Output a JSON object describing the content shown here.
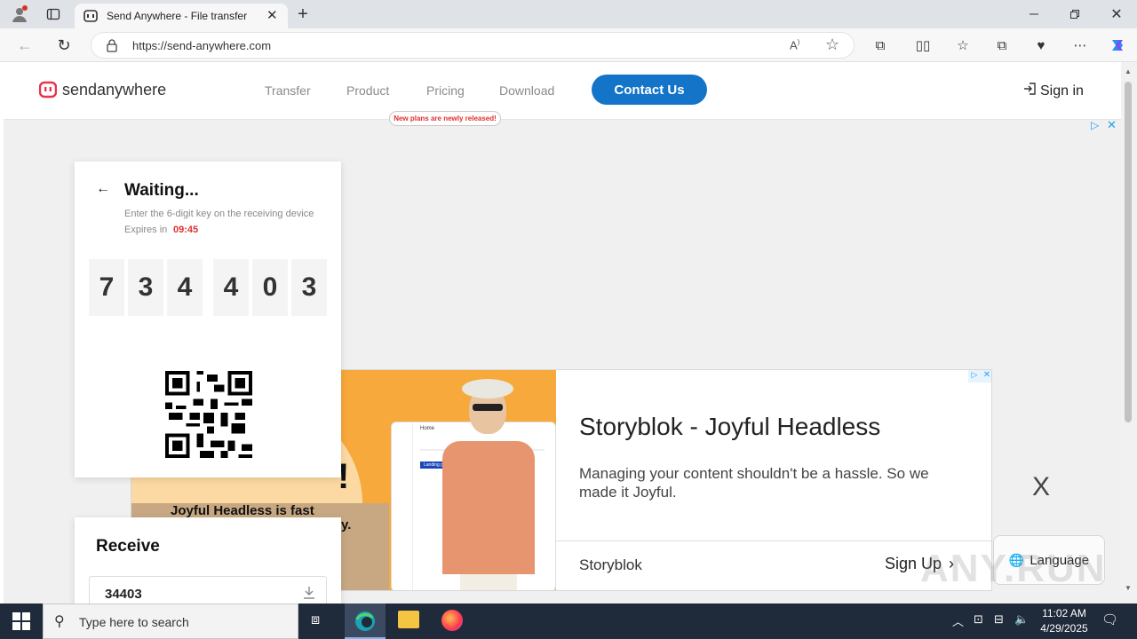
{
  "browser": {
    "tab_title": "Send Anywhere - File transfer",
    "url": "https://send-anywhere.com"
  },
  "header": {
    "logo_text": "sendanywhere",
    "nav": [
      "Transfer",
      "Product",
      "Pricing",
      "Download"
    ],
    "contact_label": "Contact Us",
    "pricing_pill": "New plans are newly released!",
    "signin_label": "Sign in"
  },
  "send_card": {
    "title": "Waiting...",
    "subtitle": "Enter the 6-digit key on the receiving device",
    "expires_label": "Expires in",
    "expires_time": "09:45",
    "digits": [
      "7",
      "3",
      "4",
      "4",
      "0",
      "3"
    ]
  },
  "receive_card": {
    "title": "Receive",
    "input_value": "34403"
  },
  "ad": {
    "headline": "Storyblok - Joyful Headless",
    "body": "Managing your content shouldn't be a hassle. So we made it Joyful.",
    "brand": "Storyblok",
    "cta": "Sign Up",
    "overlay_text": "Joyful Headless is fast",
    "overlay_partial": "y.",
    "overlay_exclaim": "!",
    "close_x": "X",
    "mockup_home": "Home",
    "mockup_landing": "Landing page"
  },
  "language_label": "Language",
  "watermark": "ANY.RUN",
  "taskbar": {
    "search_placeholder": "Type here to search",
    "time": "11:02 AM",
    "date": "4/29/2025"
  },
  "colors": {
    "accent": "#1474c7",
    "expires": "#e03131",
    "logo": "#e8344e",
    "ad_orange": "#f7a93b"
  }
}
